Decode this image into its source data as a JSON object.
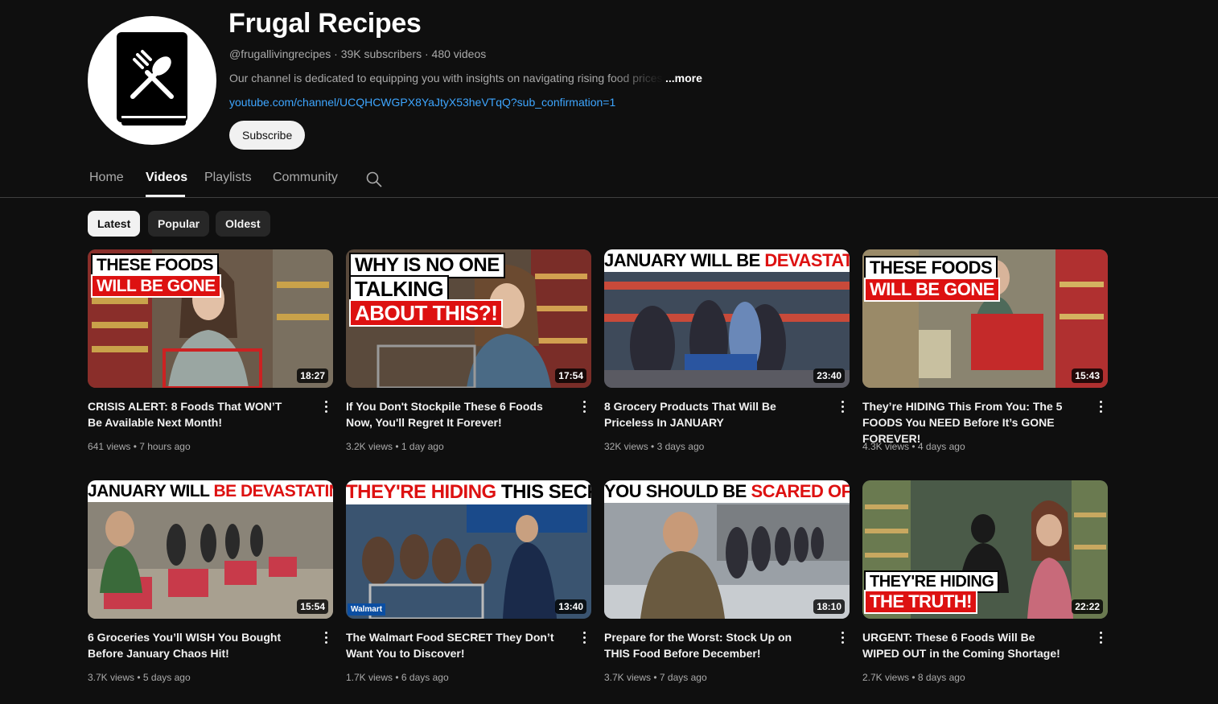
{
  "channel": {
    "name": "Frugal Recipes",
    "meta": "@frugallivingrecipes · 39K subscribers · 480 videos",
    "description": "Our channel is dedicated to equipping you with insights on navigating rising food prices a",
    "more_label": "...more",
    "link": "youtube.com/channel/UCQHCWGPX8YaJtyX53heVTqQ?sub_confirmation=1",
    "subscribe_label": "Subscribe"
  },
  "tabs": [
    "Home",
    "Videos",
    "Playlists",
    "Community"
  ],
  "active_tab": "Videos",
  "chips": [
    "Latest",
    "Popular",
    "Oldest"
  ],
  "active_chip": "Latest",
  "videos": [
    {
      "title": "CRISIS ALERT: 8 Foods That WON’T Be Available Next Month!",
      "views": "641 views",
      "age": "7 hours ago",
      "duration": "18:27",
      "overlay": [
        "THESE FOODS",
        "WILL BE GONE"
      ]
    },
    {
      "title": "If You Don't Stockpile These 6 Foods Now, You'll Regret It Forever!",
      "views": "3.2K views",
      "age": "1 day ago",
      "duration": "17:54",
      "overlay": [
        "WHY IS NO ONE",
        "TALKING",
        "ABOUT THIS?!"
      ]
    },
    {
      "title": "8 Grocery Products That Will Be Priceless In JANUARY",
      "views": "32K views",
      "age": "3 days ago",
      "duration": "23:40",
      "overlay": [
        "JANUARY WILL BE",
        "DEVASTATING"
      ]
    },
    {
      "title": "They’re HIDING This From You: The 5 FOODS You NEED Before It’s GONE FOREVER!",
      "views": "4.3K views",
      "age": "4 days ago",
      "duration": "15:43",
      "overlay": [
        "THESE FOODS",
        "WILL BE GONE"
      ]
    },
    {
      "title": "6 Groceries You’ll WISH You Bought Before January Chaos Hit!",
      "views": "3.7K views",
      "age": "5 days ago",
      "duration": "15:54",
      "overlay": [
        "JANUARY WILL",
        "BE DEVASTATING"
      ]
    },
    {
      "title": "The Walmart Food SECRET They Don’t Want You to Discover!",
      "views": "1.7K views",
      "age": "6 days ago",
      "duration": "13:40",
      "overlay": [
        "THEY'RE HIDING",
        "THIS SECRET!"
      ],
      "badge": "Walmart"
    },
    {
      "title": "Prepare for the Worst: Stock Up on THIS Food Before December!",
      "views": "3.7K views",
      "age": "7 days ago",
      "duration": "18:10",
      "overlay": [
        "YOU SHOULD BE",
        "SCARED OF THIS!"
      ]
    },
    {
      "title": "URGENT: These 6 Foods Will Be WIPED OUT in the Coming Shortage!",
      "views": "2.7K views",
      "age": "8 days ago",
      "duration": "22:22",
      "overlay": [
        "THEY'RE HIDING",
        "THE TRUTH!"
      ]
    }
  ],
  "colors": {
    "background": "#0f0f0f",
    "link": "#3ea6ff",
    "overlay_red": "#dd1111"
  },
  "icons": [
    "book-spoon-fork-icon",
    "search-icon",
    "more-vert-icon"
  ]
}
